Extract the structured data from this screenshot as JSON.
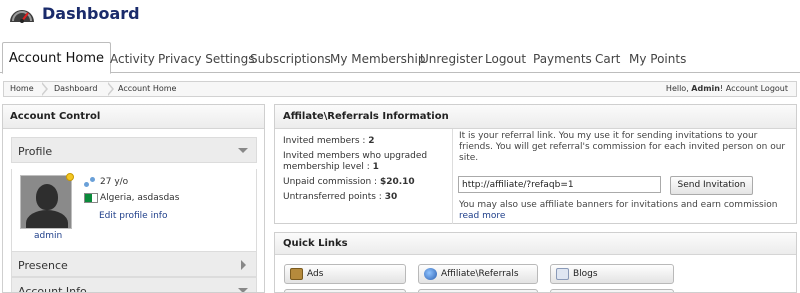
{
  "header": {
    "title": "Dashboard",
    "logo_icon": "speedometer-icon"
  },
  "tabs": [
    {
      "label": "Account Home",
      "active": true
    },
    {
      "label": "Activity"
    },
    {
      "label": "Privacy Settings"
    },
    {
      "label": "Subscriptions"
    },
    {
      "label": "My Membership"
    },
    {
      "label": "Unregister"
    },
    {
      "label": "Logout"
    },
    {
      "label": "Payments"
    },
    {
      "label": "Cart"
    },
    {
      "label": "My Points"
    }
  ],
  "breadcrumb": [
    "Home",
    "Dashboard",
    "Account Home"
  ],
  "userbar": {
    "greeting": "Hello,",
    "username": "Admin",
    "separator": "!",
    "logout_label": "Account Logout"
  },
  "account_control": {
    "title": "Account Control",
    "profile": {
      "label": "Profile",
      "avatar_name": "admin",
      "age": "27 y/o",
      "location": "Algeria, asdasdas",
      "edit_link": "Edit profile info",
      "status_color": "#f3c623"
    },
    "presence_label": "Presence",
    "account_info_label": "Account Info"
  },
  "affiliate": {
    "title": "Affilate\\Referrals Information",
    "stats": [
      {
        "label": "Invited members : ",
        "value": "2"
      },
      {
        "label": "Invited members who upgraded membership level : ",
        "value": "1"
      },
      {
        "label": "Unpaid commission : ",
        "value": "$20.10"
      },
      {
        "label": "Untransferred points : ",
        "value": "30"
      }
    ],
    "description": "It is your referral link. You my use it for sending invitations to your friends. You will get referral's commission for each invited person on our site.",
    "ref_link": "http://affiliate/?refaqb=1",
    "send_button": "Send Invitation",
    "note": "You may also use affiliate banners for invitations and earn commission",
    "read_more": "read more"
  },
  "quick_links": {
    "title": "Quick Links",
    "items": [
      {
        "label": "Ads",
        "icon": "briefcase-icon"
      },
      {
        "label": "Affiliate\\Referrals",
        "icon": "globe-icon"
      },
      {
        "label": "Blogs",
        "icon": "blog-icon"
      }
    ]
  },
  "colors": {
    "brand": "#1a2b6b",
    "link": "#1f3f8a"
  }
}
